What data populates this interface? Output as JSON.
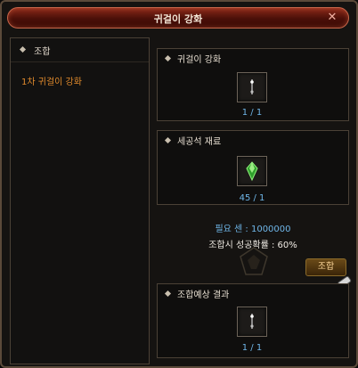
{
  "window": {
    "title": "귀걸이 강화",
    "close_icon": "close-icon"
  },
  "left_panel": {
    "header": "조합",
    "recipes": [
      "1차 귀걸이 강화"
    ]
  },
  "target": {
    "header": "귀걸이 강화",
    "count": "1 / 1",
    "icon": "earring-icon"
  },
  "material": {
    "header": "세공석 재료",
    "count": "45 / 1",
    "icon": "green-gem-icon"
  },
  "requirements": {
    "cost": "필요 센 : 1000000",
    "success_rate": "조합시 성공확률 : 60%"
  },
  "combine_button": {
    "label": "조합"
  },
  "result": {
    "header": "조합예상 결과",
    "count": "1 / 1",
    "icon": "earring-icon"
  },
  "colors": {
    "accent_orange": "#e08a2c",
    "count_blue": "#6fb6e8",
    "title_red": "#8a2a1a"
  }
}
